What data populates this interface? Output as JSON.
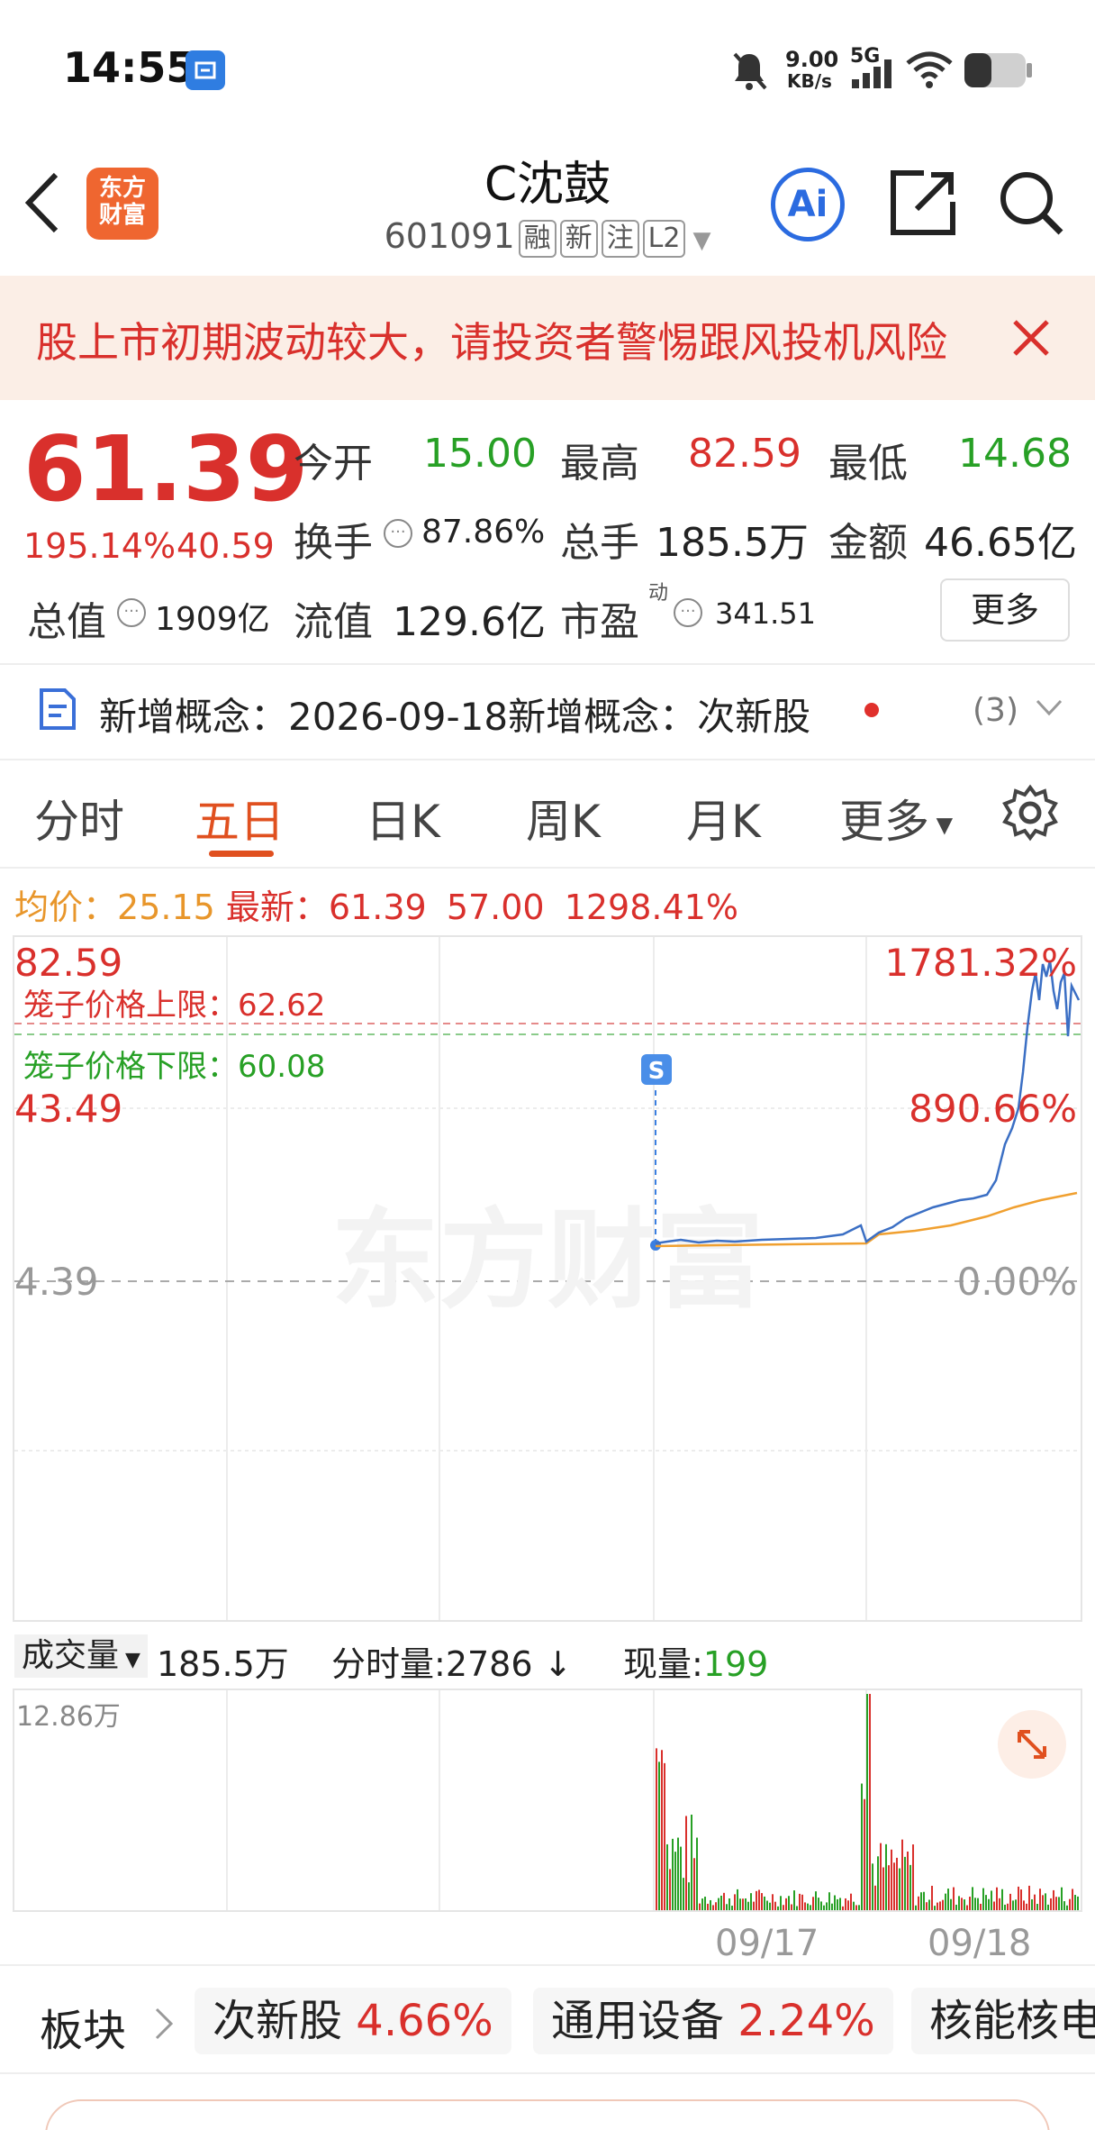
{
  "status_bar": {
    "time": "14:55",
    "speed_value": "9.00",
    "speed_unit": "KB/s",
    "network": "5G"
  },
  "header": {
    "app_logo_line1": "东方",
    "app_logo_line2": "财富",
    "title": "C沈鼓",
    "code": "601091",
    "tags": [
      "融",
      "新",
      "注",
      "L2"
    ],
    "ai_label": "Ai"
  },
  "banner": {
    "text": "股上市初期波动较大，请投资者警惕跟风投机风险"
  },
  "quote": {
    "price": "61.39",
    "change_pct": "195.14%",
    "change_abs": "40.59",
    "open_label": "今开",
    "open_value": "15.00",
    "high_label": "最高",
    "high_value": "82.59",
    "low_label": "最低",
    "low_value": "14.68",
    "turnover_label": "换手",
    "turnover_value": "87.86%",
    "volume_label": "总手",
    "volume_value": "185.5万",
    "amount_label": "金额",
    "amount_value": "46.65亿",
    "mktcap_label": "总值",
    "mktcap_value": "1909亿",
    "float_label": "流值",
    "float_value": "129.6亿",
    "pe_label": "市盈",
    "pe_sup": "动",
    "pe_value": "341.51",
    "more_label": "更多"
  },
  "concept": {
    "text": "新增概念：2026-09-18新增概念：次新股",
    "count": "(3)"
  },
  "tabs": [
    {
      "label": "分时"
    },
    {
      "label": "五日"
    },
    {
      "label": "日K"
    },
    {
      "label": "周K"
    },
    {
      "label": "月K"
    },
    {
      "label": "更多"
    }
  ],
  "legend": {
    "avg_label": "均价：",
    "avg_value": "25.15",
    "latest_label": "最新：",
    "latest_value": "61.39",
    "latest_change": "57.00",
    "latest_pct": "1298.41%"
  },
  "price_chart": {
    "top_price": "82.59",
    "top_pct": "1781.32%",
    "mid_price": "43.49",
    "mid_pct": "890.66%",
    "base_price": "4.39",
    "base_pct": "0.00%",
    "cage_upper_label": "笼子价格上限：",
    "cage_upper_value": "62.62",
    "cage_lower_label": "笼子价格下限：",
    "cage_lower_value": "60.08",
    "marker_label": "S",
    "watermark": "东方财富",
    "colors": {
      "price_line": "#3b6fc4",
      "avg_line": "#f0a030",
      "up": "#d9302c",
      "down": "#27a025"
    }
  },
  "volume": {
    "type_label": "成交量",
    "total": "185.5万",
    "minute_label": "分时量:",
    "minute_value": "2786",
    "current_label": "现量:",
    "current_value": "199",
    "max_label": "12.86万",
    "dates": [
      "09/17",
      "09/18"
    ]
  },
  "sectors": {
    "label": "板块",
    "items": [
      {
        "name": "次新股",
        "pct": "4.66%"
      },
      {
        "name": "通用设备",
        "pct": "2.24%"
      },
      {
        "name": "核能核电",
        "pct": ""
      }
    ]
  }
}
